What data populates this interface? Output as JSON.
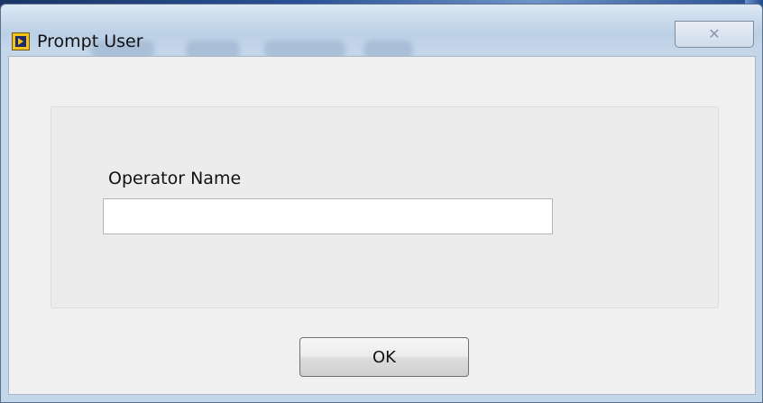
{
  "window": {
    "title": "Prompt User",
    "close_glyph": "✕"
  },
  "form": {
    "field_label": "Operator Name",
    "field_value": "",
    "field_placeholder": ""
  },
  "actions": {
    "ok_label": "OK"
  },
  "icons": {
    "app": "labview-vi-icon",
    "close": "close-icon"
  },
  "colors": {
    "window_face": "#f0f0f0",
    "title_gradient_top": "#dde8f4",
    "app_icon_yellow": "#f2c21a",
    "app_icon_navy": "#1b2a6e"
  }
}
